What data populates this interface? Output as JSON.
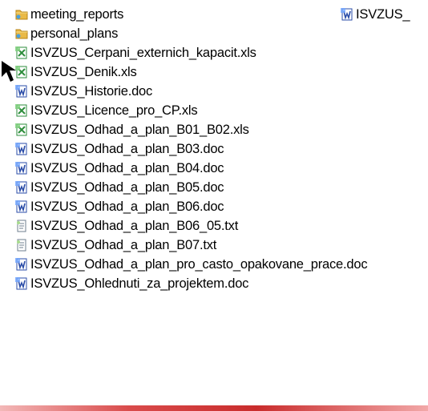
{
  "files": [
    {
      "name": "meeting_reports",
      "icon": "folder-icon"
    },
    {
      "name": "personal_plans",
      "icon": "folder-icon"
    },
    {
      "name": "ISVZUS_Cerpani_externich_kapacit.xls",
      "icon": "excel-file-icon"
    },
    {
      "name": "ISVZUS_Denik.xls",
      "icon": "excel-file-icon"
    },
    {
      "name": "ISVZUS_Historie.doc",
      "icon": "word-file-icon"
    },
    {
      "name": "ISVZUS_Licence_pro_CP.xls",
      "icon": "excel-file-icon"
    },
    {
      "name": "ISVZUS_Odhad_a_plan_B01_B02.xls",
      "icon": "excel-file-icon"
    },
    {
      "name": "ISVZUS_Odhad_a_plan_B03.doc",
      "icon": "word-file-icon"
    },
    {
      "name": "ISVZUS_Odhad_a_plan_B04.doc",
      "icon": "word-file-icon"
    },
    {
      "name": "ISVZUS_Odhad_a_plan_B05.doc",
      "icon": "word-file-icon"
    },
    {
      "name": "ISVZUS_Odhad_a_plan_B06.doc",
      "icon": "word-file-icon"
    },
    {
      "name": "ISVZUS_Odhad_a_plan_B06_05.txt",
      "icon": "text-file-icon"
    },
    {
      "name": "ISVZUS_Odhad_a_plan_B07.txt",
      "icon": "text-file-icon"
    },
    {
      "name": "ISVZUS_Odhad_a_plan_pro_casto_opakovane_prace.doc",
      "icon": "word-file-icon"
    },
    {
      "name": "ISVZUS_Ohlednuti_za_projektem.doc",
      "icon": "word-file-icon"
    }
  ],
  "second_column_item": {
    "name": "ISVZUS_",
    "icon": "word-file-icon"
  },
  "colors": {
    "folder": "#e9b947",
    "excel": "#2d8d3c",
    "word": "#2b4da8",
    "text": "#6f7f8f"
  }
}
